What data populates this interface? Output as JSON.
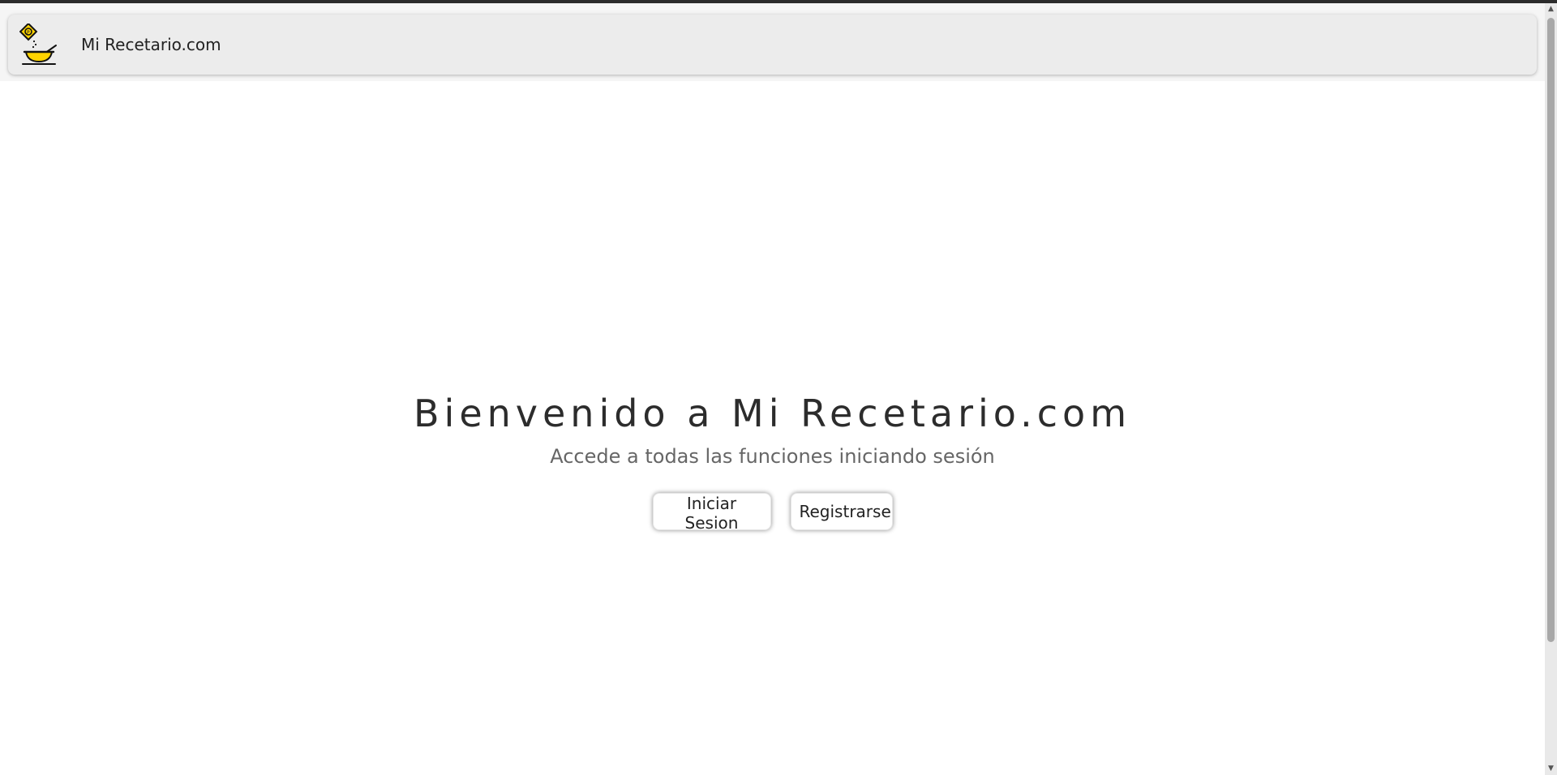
{
  "header": {
    "brand": "Mi Recetario.com",
    "logo_icon": "recipe-bowl-logo-icon"
  },
  "hero": {
    "title": "Bienvenido a Mi Recetario.com",
    "subtitle": "Accede a todas las funciones iniciando sesión",
    "login_label": "Iniciar Sesion",
    "register_label": "Registrarse"
  },
  "colors": {
    "navbar_background": "#ececec",
    "page_background": "#ffffff",
    "logo_yellow": "#ffd400",
    "title_text": "#2c2c2c",
    "subtitle_text": "#666666"
  },
  "scrollbar": {
    "up_arrow": "▲",
    "down_arrow": "▼"
  }
}
